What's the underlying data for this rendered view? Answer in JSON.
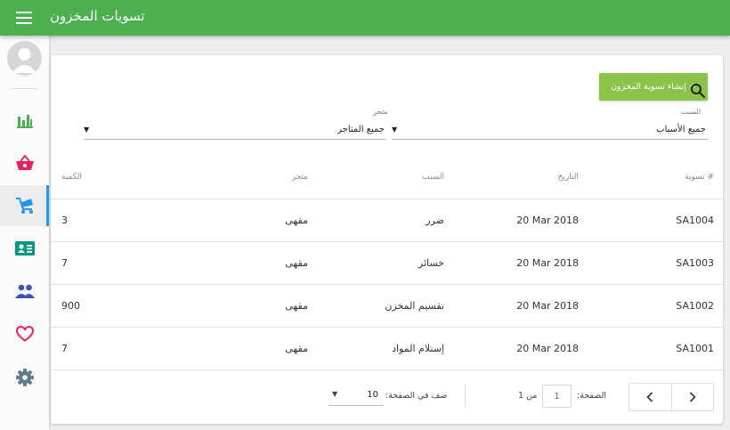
{
  "header": {
    "title": "تسويات المخزون"
  },
  "sidebar": {
    "items": [
      {
        "icon": "bar-chart-icon",
        "color": "#4caf50"
      },
      {
        "icon": "basket-icon",
        "color": "#e91e63"
      },
      {
        "icon": "cart-icon",
        "color": "#2196f3",
        "active": true
      },
      {
        "icon": "id-card-icon",
        "color": "#009688"
      },
      {
        "icon": "people-icon",
        "color": "#3f51b5"
      },
      {
        "icon": "heart-icon",
        "color": "#e91e63"
      },
      {
        "icon": "gear-icon",
        "color": "#607d8b"
      }
    ]
  },
  "toolbar": {
    "create_label": "+ إنشاء تسوية المخزون"
  },
  "filters": {
    "reason": {
      "label": "السبب",
      "value": "جميع الأسباب"
    },
    "store": {
      "label": "متجر",
      "value": "جميع المتاجر"
    }
  },
  "table": {
    "headers": {
      "number": "تسوية #",
      "date": "التاريخ",
      "reason": "السبب",
      "store": "متجر",
      "qty": "الكمية"
    },
    "rows": [
      {
        "number": "SA1004",
        "date": "20 Mar 2018",
        "reason": "ضرر",
        "store": "مقهى",
        "qty": "3"
      },
      {
        "number": "SA1003",
        "date": "20 Mar 2018",
        "reason": "خسائر",
        "store": "مقهى",
        "qty": "7"
      },
      {
        "number": "SA1002",
        "date": "20 Mar 2018",
        "reason": "تقسيم المخزن",
        "store": "مقهى",
        "qty": "900"
      },
      {
        "number": "SA1001",
        "date": "20 Mar 2018",
        "reason": "إستلام المواد",
        "store": "مقهى",
        "qty": "7"
      }
    ]
  },
  "pagination": {
    "page_label": "الصفحة:",
    "page_value": "1",
    "of_label": "من 1",
    "per_page_label": "صف في الصفحة:",
    "per_page_value": "10"
  },
  "colors": {
    "appbar": "#4caf50",
    "accent_button": "#8bc34a",
    "active_indicator": "#2196f3"
  }
}
